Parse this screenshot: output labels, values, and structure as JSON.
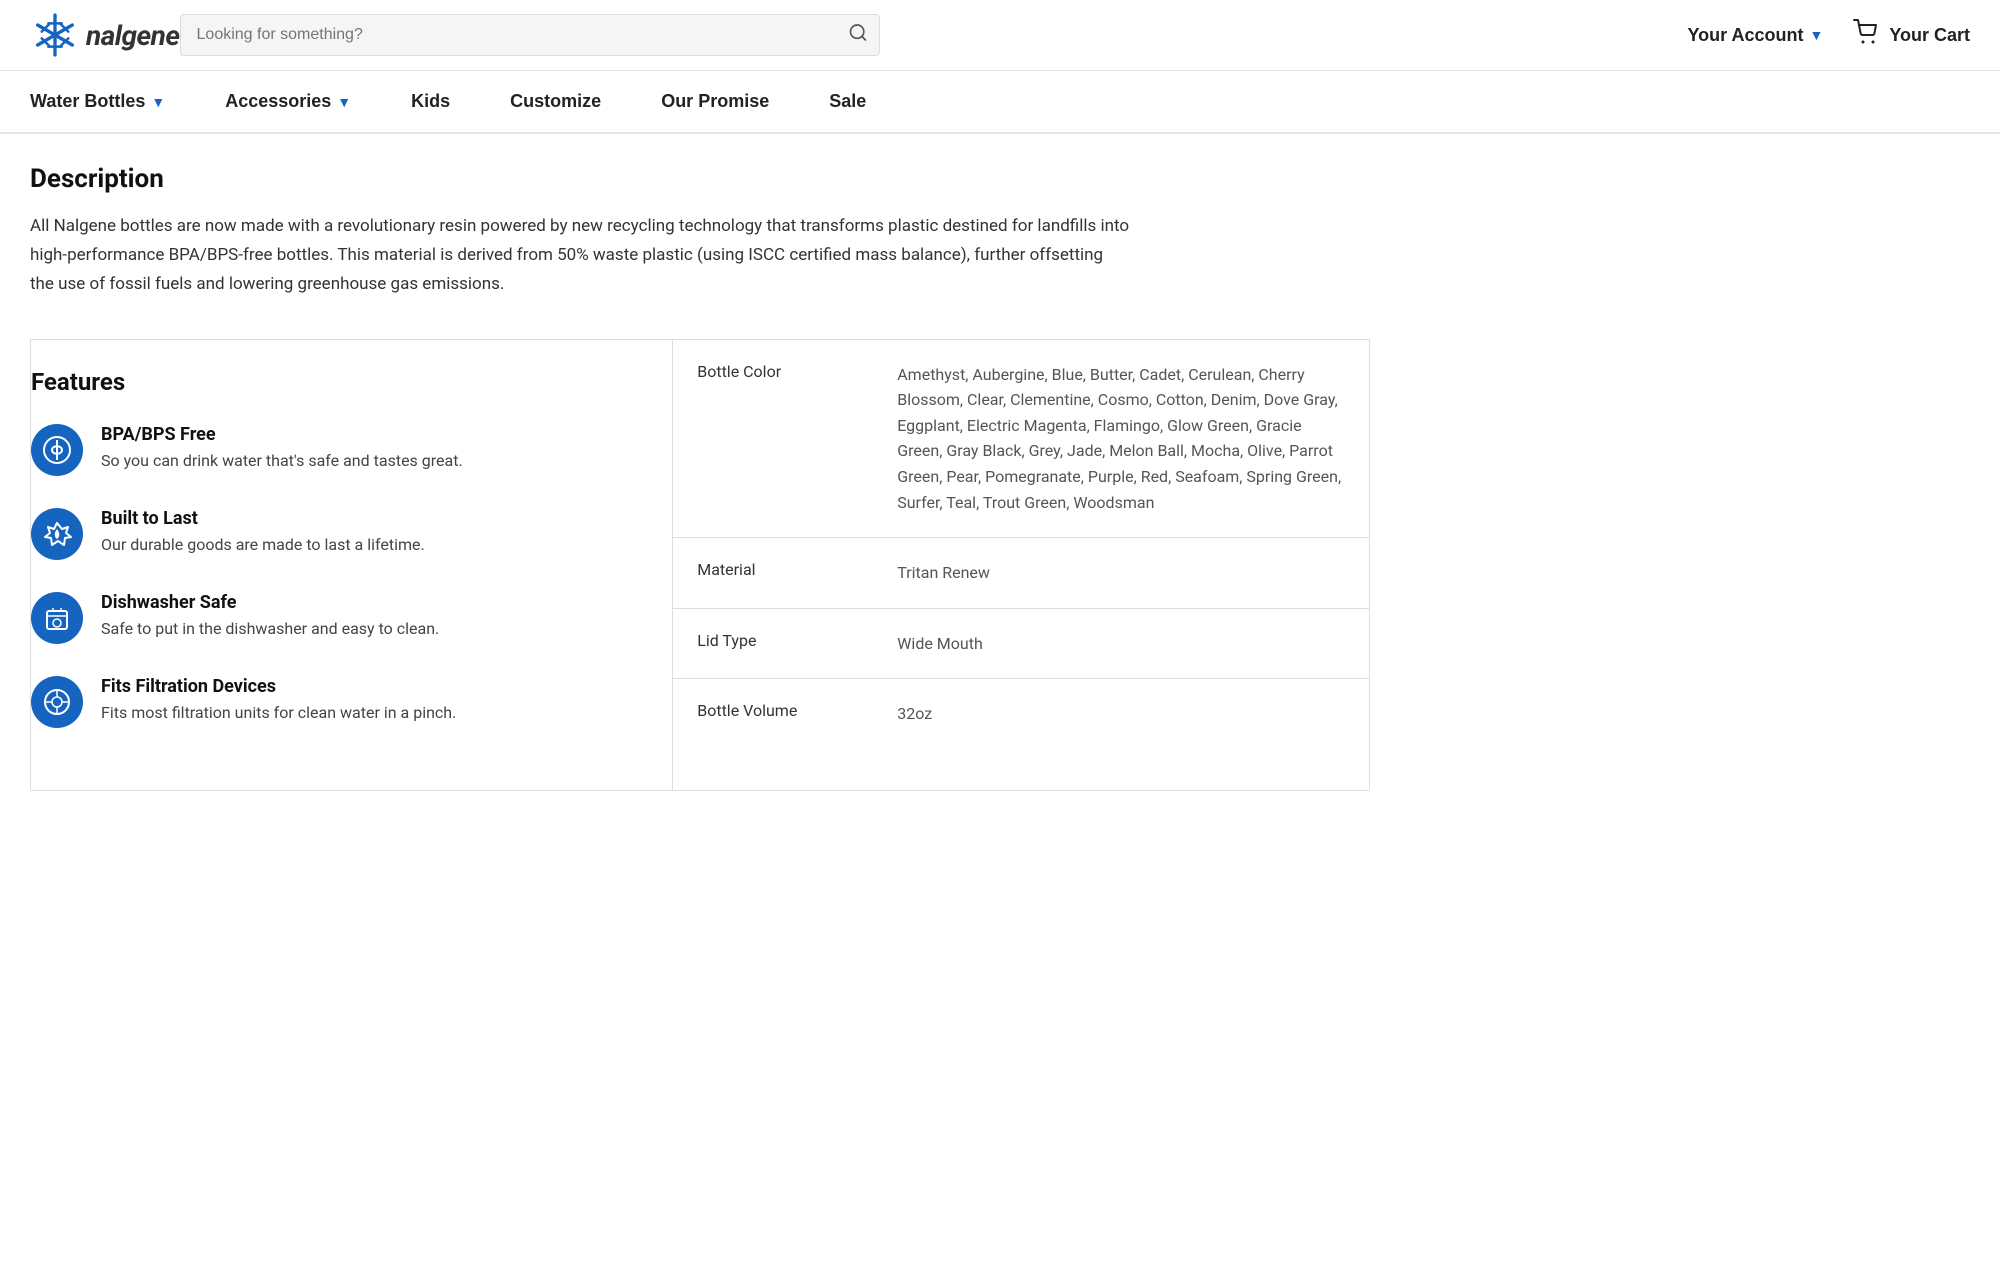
{
  "header": {
    "logo_text": "nalgene",
    "search_placeholder": "Looking for something?",
    "account_label": "Your Account",
    "cart_label": "Your Cart"
  },
  "nav": {
    "items": [
      {
        "label": "Water Bottles",
        "has_dropdown": true
      },
      {
        "label": "Accessories",
        "has_dropdown": true
      },
      {
        "label": "Kids",
        "has_dropdown": false
      },
      {
        "label": "Customize",
        "has_dropdown": false
      },
      {
        "label": "Our Promise",
        "has_dropdown": false
      },
      {
        "label": "Sale",
        "has_dropdown": false
      }
    ]
  },
  "description": {
    "title": "Description",
    "text": "All Nalgene bottles are now made with a revolutionary resin powered by new recycling technology that transforms plastic destined for landfills into high-performance BPA/BPS-free bottles. This material is derived from 50% waste plastic (using ISCC certified mass balance), further offsetting the use of fossil fuels and lowering greenhouse gas emissions."
  },
  "features": {
    "title": "Features",
    "items": [
      {
        "name": "BPA/BPS Free",
        "desc": "So you can drink water that's safe and tastes great.",
        "icon": "💧"
      },
      {
        "name": "Built to Last",
        "desc": "Our durable goods are made to last a lifetime.",
        "icon": "🔄"
      },
      {
        "name": "Dishwasher Safe",
        "desc": "Safe to put in the dishwasher and easy to clean.",
        "icon": "✦"
      },
      {
        "name": "Fits Filtration Devices",
        "desc": "Fits most filtration units for clean water in a pinch.",
        "icon": "⊕"
      }
    ]
  },
  "specs": {
    "rows": [
      {
        "label": "Bottle Color",
        "value": "Amethyst, Aubergine, Blue, Butter, Cadet, Cerulean, Cherry Blossom, Clear, Clementine, Cosmo, Cotton, Denim, Dove Gray, Eggplant, Electric Magenta, Flamingo, Glow Green, Gracie Green, Gray Black, Grey, Jade, Melon Ball, Mocha, Olive, Parrot Green, Pear, Pomegranate, Purple, Red, Seafoam, Spring Green, Surfer, Teal, Trout Green, Woodsman"
      },
      {
        "label": "Material",
        "value": "Tritan Renew"
      },
      {
        "label": "Lid Type",
        "value": "Wide Mouth"
      },
      {
        "label": "Bottle Volume",
        "value": "32oz"
      }
    ]
  }
}
